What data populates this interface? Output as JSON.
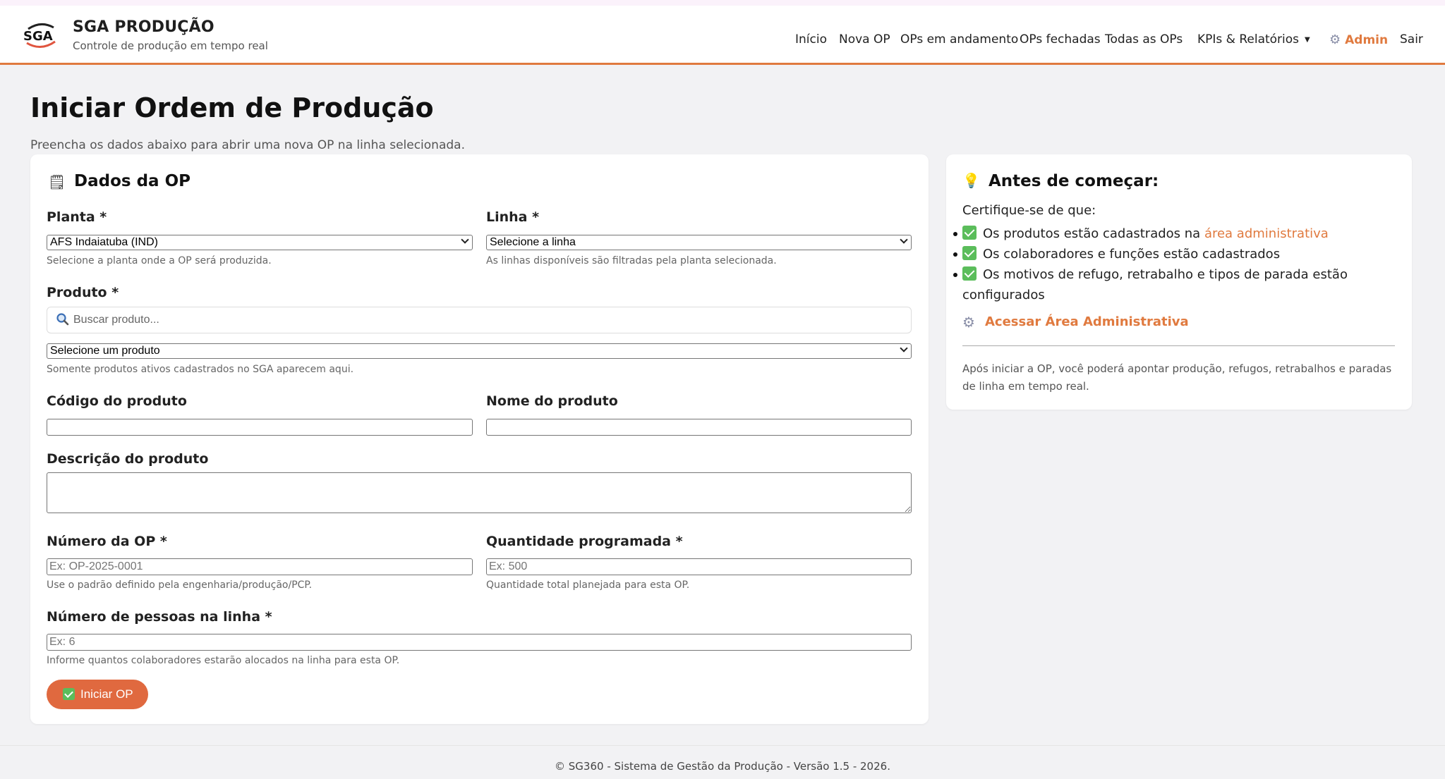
{
  "header": {
    "brand_title": "SGA PRODUÇÃO",
    "brand_subtitle": "Controle de produção em tempo real",
    "logo_text": "SGA",
    "nav": {
      "inicio": "Início",
      "nova_op": "Nova OP",
      "em_andamento": "OPs em andamento",
      "fechadas": "OPs fechadas",
      "todas": "Todas as OPs",
      "kpis": "KPIs & Relatórios",
      "admin": "Admin",
      "sair": "Sair"
    }
  },
  "page": {
    "title": "Iniciar Ordem de Produção",
    "subtitle": "Preencha os dados abaixo para abrir uma nova OP na linha selecionada."
  },
  "form": {
    "title": "Dados da OP",
    "planta": {
      "label": "Planta *",
      "value": "AFS Indaiatuba (IND)",
      "hint": "Selecione a planta onde a OP será produzida."
    },
    "linha": {
      "label": "Linha *",
      "value": "Selecione a linha",
      "hint": "As linhas disponíveis são filtradas pela planta selecionada."
    },
    "produto": {
      "label": "Produto *",
      "search_placeholder": "Buscar produto...",
      "select_value": "Selecione um produto",
      "hint": "Somente produtos ativos cadastrados no SGA aparecem aqui."
    },
    "codigo": {
      "label": "Código do produto",
      "value": ""
    },
    "nome": {
      "label": "Nome do produto",
      "value": ""
    },
    "descricao": {
      "label": "Descrição do produto",
      "value": ""
    },
    "numero_op": {
      "label": "Número da OP *",
      "placeholder": "Ex: OP-2025-0001",
      "hint": "Use o padrão definido pela engenharia/produção/PCP."
    },
    "quantidade": {
      "label": "Quantidade programada *",
      "placeholder": "Ex: 500",
      "hint": "Quantidade total planejada para esta OP."
    },
    "pessoas": {
      "label": "Número de pessoas na linha *",
      "placeholder": "Ex: 6",
      "hint": "Informe quantos colaboradores estarão alocados na linha para esta OP."
    },
    "submit_label": "Iniciar OP"
  },
  "info": {
    "title": "Antes de começar:",
    "intro": "Certifique-se de que:",
    "items": [
      {
        "text": "Os produtos estão cadastrados na ",
        "link": "área administrativa"
      },
      {
        "text": "Os colaboradores e funções estão cadastrados"
      },
      {
        "text": "Os motivos de refugo, retrabalho e tipos de parada estão configurados"
      }
    ],
    "admin_link": "Acessar Área Administrativa",
    "note": "Após iniciar a OP, você poderá apontar produção, refugos, retrabalhos e paradas de linha em tempo real."
  },
  "footer": {
    "text": "© SG360 - Sistema de Gestão da Produção - Versão 1.5 - 2026."
  },
  "colors": {
    "accent": "#e07a3f",
    "button": "#e0693f",
    "check_green": "#5bbd5b",
    "background": "#f2f2f4"
  },
  "icons": {
    "form_title": "clipboard-icon",
    "info_title": "lightbulb-icon",
    "admin": "gear-icon",
    "search": "search-icon",
    "check": "check-icon"
  }
}
